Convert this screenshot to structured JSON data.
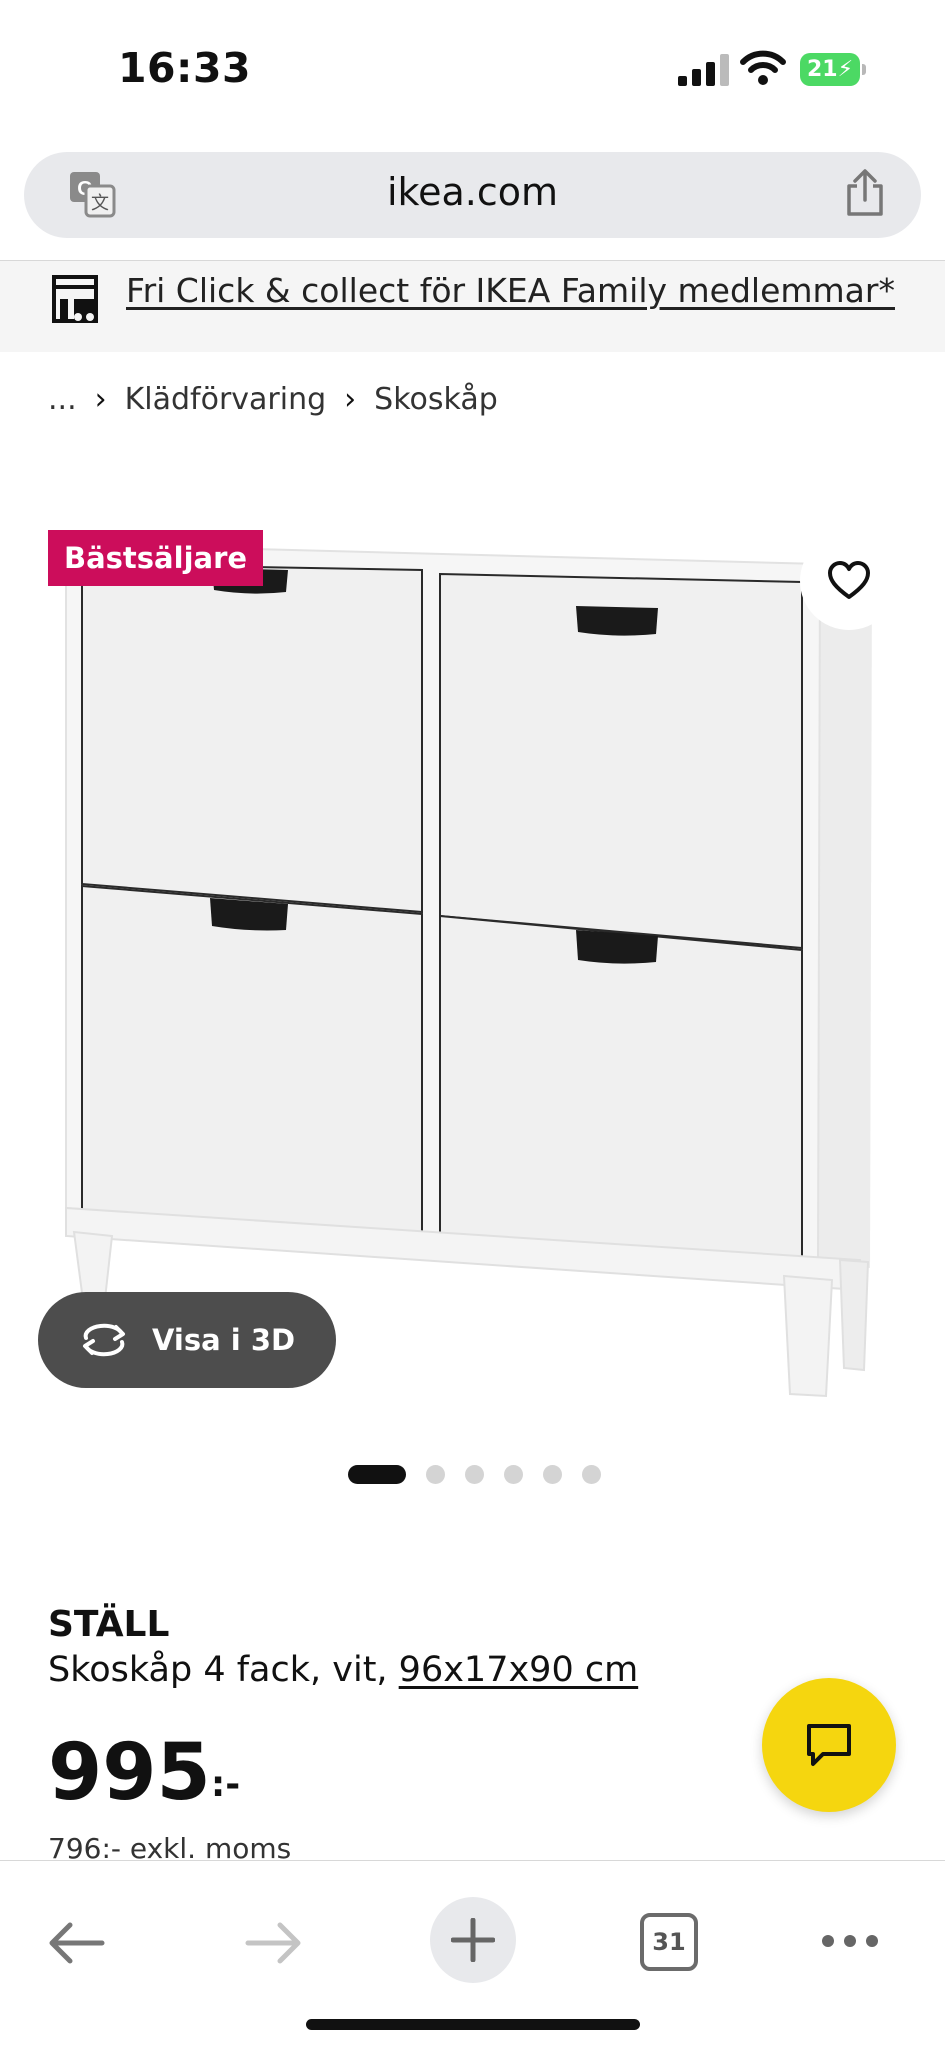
{
  "status_bar": {
    "time": "16:33",
    "battery_level": "21",
    "icons": [
      "cellular-signal-icon",
      "wifi-icon",
      "battery-charging-icon"
    ]
  },
  "browser": {
    "url": "ikea.com",
    "icons": [
      "translate-icon",
      "share-icon"
    ]
  },
  "promo": {
    "text": "Fri Click & collect för IKEA Family medlemmar*",
    "icon": "store-icon"
  },
  "breadcrumb": {
    "items": [
      "...",
      "Klädförvaring",
      "Skoskåp"
    ]
  },
  "gallery": {
    "badge": "Bästsäljare",
    "view_3d_label": "Visa i 3D",
    "dot_count": 6,
    "active_dot": 1,
    "icons": [
      "heart-icon",
      "rotate-3d-icon"
    ]
  },
  "product": {
    "name": "STÄLL",
    "description": "Skoskåp 4 fack, vit, ",
    "dimensions": "96x17x90 cm",
    "price": "995",
    "price_suffix": ":-",
    "price_excl_vat": "796:- exkl. moms"
  },
  "chat": {
    "icon": "chat-icon"
  },
  "toolbar": {
    "tab_count": "31",
    "icons": [
      "back-arrow-icon",
      "forward-arrow-icon",
      "plus-icon",
      "tabs-icon",
      "more-icon"
    ]
  },
  "colors": {
    "badge": "#cc0d5b",
    "chat_button": "#f5d60f",
    "url_bar": "#e8e9ec",
    "battery": "#4cd964"
  }
}
